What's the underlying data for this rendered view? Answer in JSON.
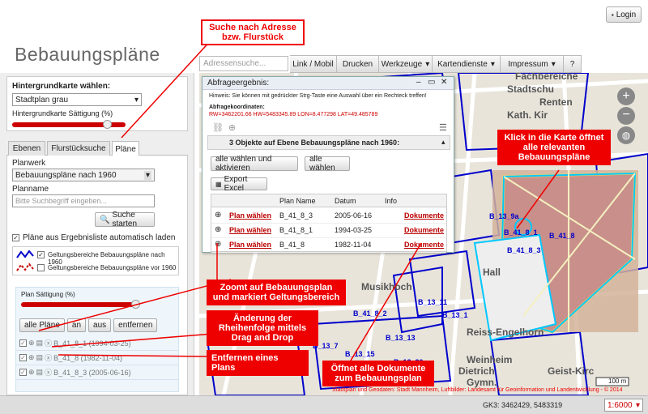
{
  "header": {
    "title": "Bebauungspläne",
    "login": "Login",
    "search_placeholder": "Adressensuche..."
  },
  "nav": [
    {
      "label": "Link / Mobil",
      "dd": false
    },
    {
      "label": "Drucken",
      "dd": false
    },
    {
      "label": "Werkzeuge",
      "dd": true
    },
    {
      "label": "Kartendienste",
      "dd": true
    },
    {
      "label": "Impressum",
      "dd": true
    },
    {
      "label": "?",
      "dd": false
    }
  ],
  "left": {
    "bg_label": "Hintergrundkarte wählen:",
    "bg_value": "Stadtplan grau",
    "saturation_label": "Hintergrundkarte Sättigung (%)",
    "tabs": [
      "Ebenen",
      "Flurstücksuche",
      "Pläne"
    ],
    "planwerk_label": "Planwerk",
    "planwerk_value": "Bebauungspläne nach 1960",
    "planname_label": "Planname",
    "planname_placeholder": "Bitte Suchbegriff eingeben...",
    "search_button": "Suche starten",
    "auto_load": "Pläne aus Ergebnisliste automatisch laden",
    "legend": [
      "Geltungsbereiche Bebauungspläne nach 1960",
      "Geltungsbereiche Bebauungspläne vor 1960"
    ],
    "plan_sat_label": "Plan Sättigung (%)",
    "list_buttons": [
      "alle Pläne",
      "an",
      "aus",
      "entfernen"
    ],
    "plans": [
      "B_41_8_1 (1994-03-25)",
      "B_41_8 (1982-11-04)",
      "B_41_8_3 (2005-06-16)"
    ]
  },
  "dialog": {
    "title": "Abfrageergebnis:",
    "hint": "Hinweis: Sie können mit gedrückter Strg-Taste eine Auswahl über ein Rechteck treffen!",
    "coord_label": "Abfragekoordinaten:",
    "coords": "RW=3462201.66 HW=5483345.89 LON=8.477298 LAT=49.485789",
    "section": "3 Objekte auf Ebene Bebauungspläne nach 1960:",
    "btn_all_activate": "alle wählen und aktivieren",
    "btn_all": "alle wählen",
    "export": "Export Excel",
    "columns": [
      "",
      "",
      "Plan Name",
      "Datum",
      "Info",
      ""
    ],
    "rows": [
      {
        "action": "Plan wählen",
        "name": "B_41_8_3",
        "date": "2005-06-16",
        "docs": "Dokumente"
      },
      {
        "action": "Plan wählen",
        "name": "B_41_8_1",
        "date": "1994-03-25",
        "docs": "Dokumente"
      },
      {
        "action": "Plan wählen",
        "name": "B_41_8",
        "date": "1982-11-04",
        "docs": "Dokumente"
      }
    ]
  },
  "map": {
    "labels": [
      "Fachbereiche",
      "Stadtschu",
      "Renten",
      "Kath. Kir",
      "B_13_9a",
      "B_41_8",
      "B_41_8_1",
      "B_41_8_3",
      "Musikhoch",
      "B_13_11",
      "B_13_1",
      "B_13_13",
      "B_13_15",
      "B_13_20",
      "Weinheim",
      "Reiss-Engelhorn",
      "Dietrich",
      "Geist-Kirc",
      "Gymn.",
      "B_41_8_2",
      "B_13_7",
      "Hall"
    ],
    "scale": "100 m",
    "attribution": "Stadtplan und Geodaten: Stadt Mannheim, Luftbilder: Landesamt für Geoinformation und Landentwicklung - © 2014"
  },
  "status": {
    "coords": "GK3: 3462429, 5483319",
    "scale": "1:6000"
  },
  "callouts": {
    "search": "Suche nach Adresse bzw. Flurstück",
    "map_click": "Klick in die Karte öffnet alle relevanten Bebauungspläne",
    "zoom": "Zoomt auf Bebauungsplan und markiert Geltungsbereich",
    "reorder": "Änderung der Rheihenfolge mittels Drag and Drop",
    "remove": "Entfernen eines Plans",
    "docs": "Öffnet alle Dokumente zum Bebauungsplan"
  },
  "colors": {
    "accent_red": "#e00000",
    "plan_blue": "#0000cc",
    "link_red": "#b00000"
  }
}
